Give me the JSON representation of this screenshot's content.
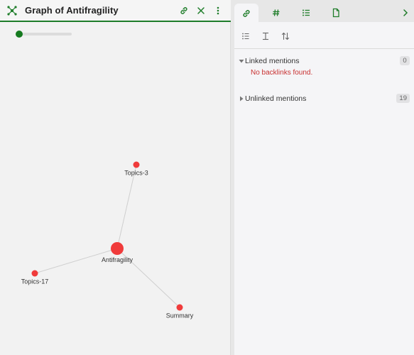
{
  "graph": {
    "title": "Graph of Antifragility",
    "actions": [
      {
        "name": "link-icon"
      },
      {
        "name": "close-icon"
      },
      {
        "name": "more-options-icon"
      }
    ],
    "zoom_level": 0,
    "accent_color": "#1f7d2a",
    "node_color": "#f03b3b",
    "nodes": [
      {
        "id": "Antifragility",
        "label": "Antifragility",
        "primary": true
      },
      {
        "id": "Topics-3",
        "label": "Topics-3",
        "primary": false
      },
      {
        "id": "Topics-17",
        "label": "Topics-17",
        "primary": false
      },
      {
        "id": "Summary",
        "label": "Summary",
        "primary": false
      }
    ],
    "edges": [
      [
        "Antifragility",
        "Topics-3"
      ],
      [
        "Antifragility",
        "Topics-17"
      ],
      [
        "Antifragility",
        "Summary"
      ]
    ]
  },
  "sidebar": {
    "tabs": [
      {
        "name": "backlinks-tab",
        "icon": "link-icon",
        "active": true
      },
      {
        "name": "tags-tab",
        "icon": "hash-icon",
        "active": false
      },
      {
        "name": "outline-tab",
        "icon": "list-icon",
        "active": false
      },
      {
        "name": "file-tab",
        "icon": "file-icon",
        "active": false
      }
    ],
    "toolbar": [
      {
        "name": "collapse-results-icon"
      },
      {
        "name": "show-more-context-icon"
      },
      {
        "name": "change-sort-order-icon"
      }
    ],
    "linked": {
      "label": "Linked mentions",
      "count": "0",
      "empty_message": "No backlinks found."
    },
    "unlinked": {
      "label": "Unlinked mentions",
      "count": "19"
    }
  }
}
